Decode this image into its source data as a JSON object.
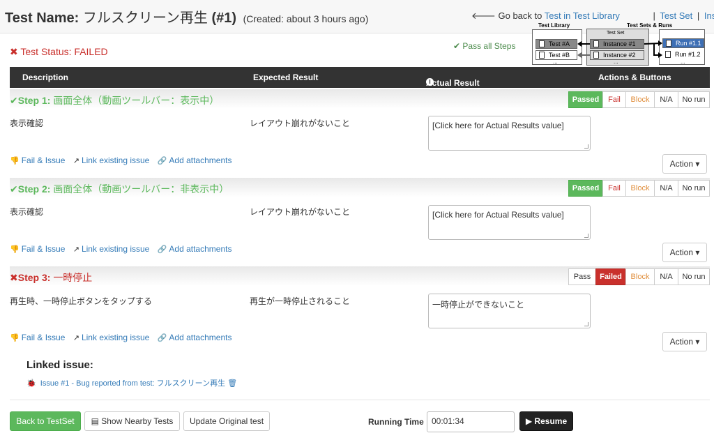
{
  "header": {
    "test_name_label": "Test Name:",
    "test_name": "フルスクリーン再生",
    "test_id": "(#1)",
    "created": "(Created: about 3 hours ago)",
    "back_arrow": "🡐",
    "back_prefix": "Go back to",
    "back_link": "Test in Test Library",
    "sep": "|",
    "test_set_link": "Test Set",
    "instance_link": "Instance"
  },
  "status": {
    "icon": "✖",
    "text": "Test Status: FAILED",
    "pass_all_icon": "✔",
    "pass_all": "Pass all Steps"
  },
  "diagram": {
    "library_header": "Test Library",
    "sets_header": "Test Sets & Runs",
    "set_label": "Test Set",
    "test_a": "Test #A",
    "test_b": "Test #B",
    "instance_1": "Instance #1",
    "instance_2": "Instance #2",
    "run_1": "Run #1.1",
    "run_2": "Run #1.2",
    "dots": "..."
  },
  "table": {
    "col_description": "Description",
    "col_expected": "Expected Result",
    "col_actual": "Actual Result",
    "col_actions": "Actions & Buttons",
    "info_icon": "i"
  },
  "buttons": {
    "passed": "Passed",
    "pass": "Pass",
    "fail": "Fail",
    "failed": "Failed",
    "block": "Block",
    "na": "N/A",
    "norun": "No run"
  },
  "steps": [
    {
      "icon": "✔",
      "label": "Step 1:",
      "title": "画面全体（動画ツールバー：表示中）",
      "description": "表示確認",
      "expected": "レイアウト崩れがないこと",
      "actual": "[Click here for Actual Results value]"
    },
    {
      "icon": "✔",
      "label": "Step 2:",
      "title": "画面全体（動画ツールバー：非表示中）",
      "description": "表示確認",
      "expected": "レイアウト崩れがないこと",
      "actual": "[Click here for Actual Results value]"
    },
    {
      "icon": "✖",
      "label": "Step 3:",
      "title": "一時停止",
      "description": "再生時、一時停止ボタンをタップする",
      "expected": "再生が一時停止されること",
      "actual": "一時停止ができないこと"
    }
  ],
  "links": {
    "fail_issue_icon": "👎",
    "fail_issue": "Fail & Issue",
    "link_existing_icon": "↗",
    "link_existing": "Link existing issue",
    "attach_icon": "🔗",
    "attach": "Add attachments",
    "action": "Action ▾"
  },
  "linked": {
    "title": "Linked issue:",
    "bug_icon": "🐞",
    "issue": "Issue #1 - Bug reported from test: フルスクリーン再生",
    "trash_icon": "🗑"
  },
  "footer": {
    "back": "Back to TestSet",
    "nearby_icon": "▤",
    "nearby": "Show Nearby Tests",
    "update": "Update Original test",
    "running_label": "Running Time",
    "running_value": "00:01:34",
    "resume": "▶ Resume"
  }
}
